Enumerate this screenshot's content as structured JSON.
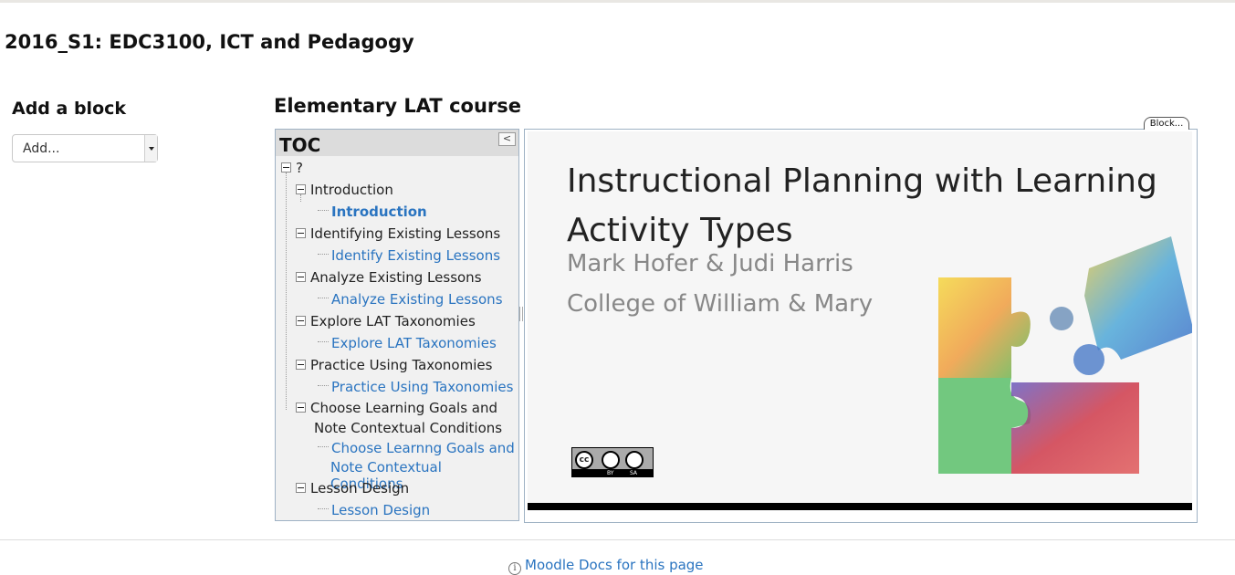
{
  "course": {
    "title": "2016_S1: EDC3100, ICT and Pedagogy"
  },
  "add_block": {
    "title": "Add a block",
    "select_value": "Add..."
  },
  "section": {
    "title": "Elementary LAT course"
  },
  "toc": {
    "title": "TOC",
    "collapse_label": "<",
    "root": "?",
    "items": [
      {
        "chapter": "Introduction",
        "page": "Introduction"
      },
      {
        "chapter": "Identifying Existing Lessons",
        "page": "Identify Existing Lessons"
      },
      {
        "chapter": "Analyze Existing Lessons",
        "page": "Analyze Existing Lessons"
      },
      {
        "chapter": "Explore LAT Taxonomies",
        "page": "Explore LAT Taxonomies"
      },
      {
        "chapter": "Practice Using Taxonomies",
        "page": "Practice Using Taxonomies"
      },
      {
        "chapter_line1": "Choose Learning Goals and",
        "chapter_line2": "Note Contextual Conditions",
        "page_line1": "Choose Learnng Goals and",
        "page_line2": "Note Contextual Conditions"
      },
      {
        "chapter": "Lesson Design",
        "page": "Lesson Design"
      }
    ]
  },
  "block_tab": {
    "label": "Block..."
  },
  "slide": {
    "title": "Instructional Planning with Learning Activity Types",
    "author": "Mark Hofer & Judi Harris",
    "organization": "College of William & Mary",
    "license_by": "BY",
    "license_sa": "SA",
    "license_cc": "cc"
  },
  "footer": {
    "docs_link": "Moodle Docs for this page",
    "info_icon": "i"
  },
  "colors": {
    "link": "#2a74c0",
    "panel_border": "#9fb2c4"
  }
}
